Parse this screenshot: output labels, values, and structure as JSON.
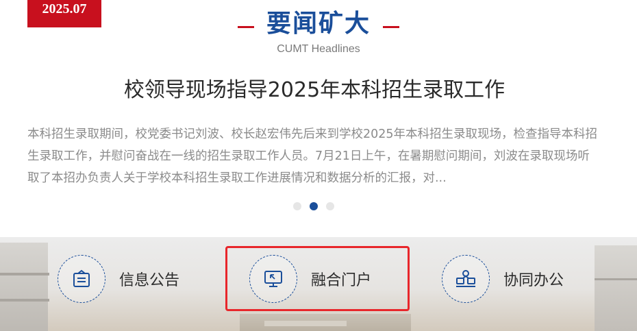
{
  "news": {
    "date": "2025.07",
    "section_title": "要闻矿大",
    "section_subtitle": "CUMT Headlines",
    "headline": "校领导现场指导2025年本科招生录取工作",
    "summary": "本科招生录取期间，校党委书记刘波、校长赵宏伟先后来到学校2025年本科招生录取现场，检查指导本科招生录取工作，并慰问奋战在一线的招生录取工作人员。7月21日上午，在暑期慰问期间，刘波在录取现场听取了本招办负责人关于学校本科招生录取工作进展情况和数据分析的汇报，对...",
    "carousel": {
      "count": 3,
      "active": 2
    }
  },
  "quick_links": [
    {
      "label": "信息公告",
      "icon": "notice-board-icon"
    },
    {
      "label": "融合门户",
      "icon": "monitor-cursor-icon"
    },
    {
      "label": "协同办公",
      "icon": "collaboration-icon"
    }
  ],
  "colors": {
    "brand_red": "#c8101e",
    "brand_blue": "#1a4e9a",
    "highlight_red": "#e8262b"
  }
}
